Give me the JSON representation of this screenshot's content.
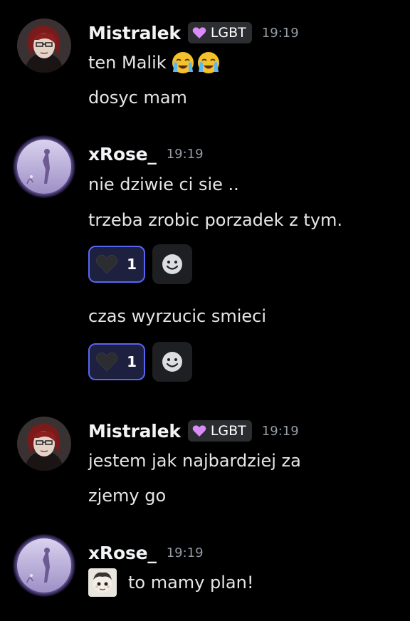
{
  "messages": [
    {
      "author": "Mistralek",
      "tag": "LGBT",
      "time": "19:19",
      "lines": [
        "ten Malik",
        "dosyc mam"
      ]
    },
    {
      "author": "xRose_",
      "time": "19:19",
      "lines": [
        "nie dziwie ci sie ..",
        "trzeba zrobic porzadek z tym.",
        "czas wyrzucic smieci"
      ],
      "reactions": [
        {
          "icon": "black-heart-icon",
          "count": "1"
        },
        {
          "icon": "black-heart-icon",
          "count": "1"
        }
      ]
    },
    {
      "author": "Mistralek",
      "tag": "LGBT",
      "time": "19:19",
      "lines": [
        "jestem jak najbardziej za",
        "zjemy go"
      ]
    },
    {
      "author": "xRose_",
      "time": "19:19",
      "lines": [
        "to mamy plan!"
      ]
    }
  ],
  "icons": {
    "tag_icon": "purple-heart-icon",
    "crying_emoji": "loudly-crying-face-emoji",
    "add_reaction": "smiley-face-icon"
  },
  "colors": {
    "background": "#000000",
    "username": "#f2f3f5",
    "timestamp": "#949ba4",
    "reaction_border": "#5865f2",
    "tag_heart": "#d98cf7"
  }
}
